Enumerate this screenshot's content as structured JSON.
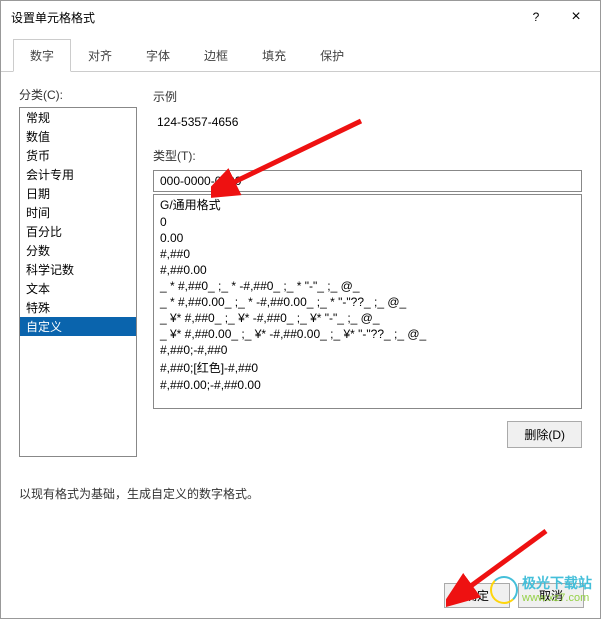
{
  "title": "设置单元格格式",
  "window_buttons": {
    "help": "?",
    "close": "×"
  },
  "tabs": [
    {
      "label": "数字",
      "active": true
    },
    {
      "label": "对齐",
      "active": false
    },
    {
      "label": "字体",
      "active": false
    },
    {
      "label": "边框",
      "active": false
    },
    {
      "label": "填充",
      "active": false
    },
    {
      "label": "保护",
      "active": false
    }
  ],
  "category_label": "分类(C):",
  "categories": [
    {
      "label": "常规",
      "selected": false
    },
    {
      "label": "数值",
      "selected": false
    },
    {
      "label": "货币",
      "selected": false
    },
    {
      "label": "会计专用",
      "selected": false
    },
    {
      "label": "日期",
      "selected": false
    },
    {
      "label": "时间",
      "selected": false
    },
    {
      "label": "百分比",
      "selected": false
    },
    {
      "label": "分数",
      "selected": false
    },
    {
      "label": "科学记数",
      "selected": false
    },
    {
      "label": "文本",
      "selected": false
    },
    {
      "label": "特殊",
      "selected": false
    },
    {
      "label": "自定义",
      "selected": true
    }
  ],
  "sample_label": "示例",
  "sample_value": "124-5357-4656",
  "type_label": "类型(T):",
  "type_value": "000-0000-0000",
  "format_options": [
    "G/通用格式",
    "0",
    "0.00",
    "#,##0",
    "#,##0.00",
    "_ * #,##0_ ;_ * -#,##0_ ;_ * \"-\"_ ;_ @_ ",
    "_ * #,##0.00_ ;_ * -#,##0.00_ ;_ * \"-\"??_ ;_ @_ ",
    "_ ¥* #,##0_ ;_ ¥* -#,##0_ ;_ ¥* \"-\"_ ;_ @_ ",
    "_ ¥* #,##0.00_ ;_ ¥* -#,##0.00_ ;_ ¥* \"-\"??_ ;_ @_ ",
    "#,##0;-#,##0",
    "#,##0;[红色]-#,##0",
    "#,##0.00;-#,##0.00"
  ],
  "delete_label": "删除(D)",
  "description": "以现有格式为基础，生成自定义的数字格式。",
  "ok_label": "确定",
  "cancel_label": "取消",
  "watermark": {
    "line1": "极光下载站",
    "line2": "www.xz7.com"
  }
}
